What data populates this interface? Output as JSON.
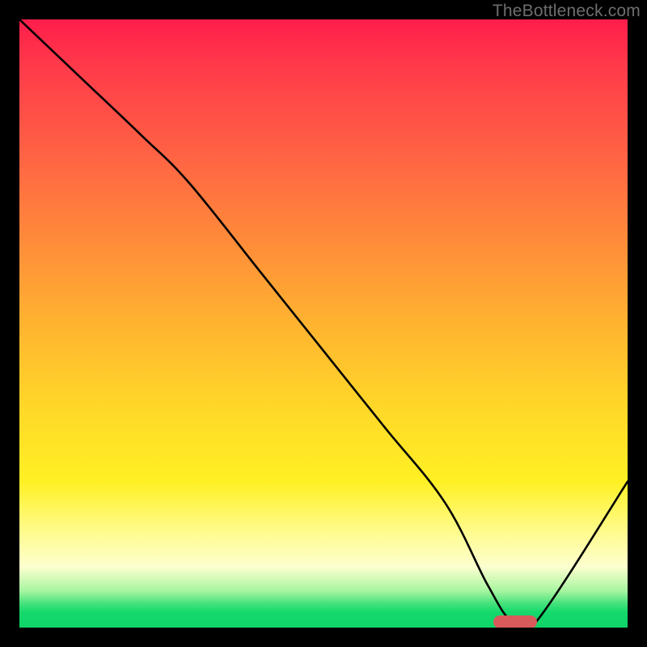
{
  "watermark": "TheBottleneck.com",
  "chart_data": {
    "type": "line",
    "title": "",
    "xlabel": "",
    "ylabel": "",
    "xlim": [
      0,
      100
    ],
    "ylim": [
      0,
      100
    ],
    "x": [
      0,
      10,
      20,
      28,
      40,
      50,
      60,
      70,
      77,
      81,
      85,
      100
    ],
    "y": [
      100,
      90.5,
      81,
      73,
      58,
      45.5,
      33,
      20.5,
      7,
      1,
      1,
      24
    ],
    "curve_notes": "Single bottleneck curve. Steeper drop after x≈28, flat minimum around x≈80–85, then rises linearly.",
    "marker": {
      "x_center": 81.5,
      "x_halfwidth": 3.5,
      "y": 1
    },
    "background_gradient": [
      {
        "pos": 0.0,
        "color": "#ff1d4b"
      },
      {
        "pos": 0.5,
        "color": "#ffb330"
      },
      {
        "pos": 0.8,
        "color": "#fff024"
      },
      {
        "pos": 0.95,
        "color": "#46e27c"
      },
      {
        "pos": 1.0,
        "color": "#0fd468"
      }
    ]
  }
}
